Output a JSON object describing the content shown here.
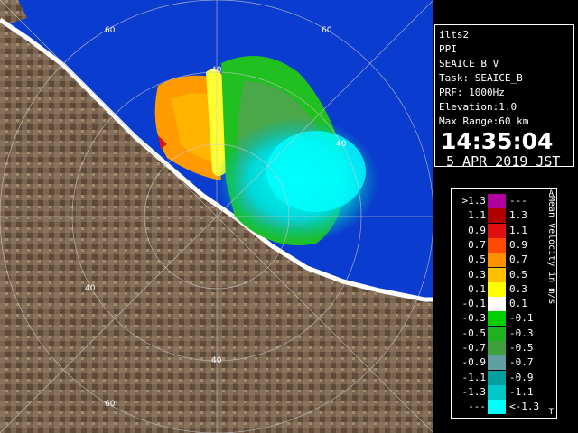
{
  "info": {
    "station": "ilts2",
    "mode": "PPI",
    "product": "SEAICE_B_V",
    "task": "Task: SEAICE_B",
    "prf": "PRF: 1000Hz",
    "elevation": "Elevation:1.0",
    "max_range": "Max Range:60 km",
    "time": "14:35:04",
    "date": "5 APR 2019 JST"
  },
  "legend": {
    "title": "Mean Velocity in m/s",
    "top_marker": "A",
    "bottom_marker": "T",
    "rows": [
      {
        "left": ">1.3",
        "right": "---",
        "color": "#b000a0"
      },
      {
        "left": "1.1",
        "right": "1.3",
        "color": "#b00000"
      },
      {
        "left": "0.9",
        "right": "1.1",
        "color": "#e01010"
      },
      {
        "left": "0.7",
        "right": "0.9",
        "color": "#ff4a00"
      },
      {
        "left": "0.5",
        "right": "0.7",
        "color": "#ff9000"
      },
      {
        "left": "0.3",
        "right": "0.5",
        "color": "#ffc000"
      },
      {
        "left": "0.1",
        "right": "0.3",
        "color": "#ffff00"
      },
      {
        "left": "-0.1",
        "right": "0.1",
        "color": "#ffffff"
      },
      {
        "left": "-0.3",
        "right": "-0.1",
        "color": "#00d000"
      },
      {
        "left": "-0.5",
        "right": "-0.3",
        "color": "#20b020"
      },
      {
        "left": "-0.7",
        "right": "-0.5",
        "color": "#40a040"
      },
      {
        "left": "-0.9",
        "right": "-0.7",
        "color": "#60a0a0"
      },
      {
        "left": "-1.1",
        "right": "-0.9",
        "color": "#00a0a0"
      },
      {
        "left": "-1.3",
        "right": "-1.1",
        "color": "#00c8c8"
      },
      {
        "left": "---",
        "right": "<-1.3",
        "color": "#00ffff"
      }
    ]
  },
  "map": {
    "range_labels": [
      "60",
      "60",
      "40",
      "40",
      "40",
      "40",
      "60"
    ],
    "colors": {
      "sea": "#0a3cd0",
      "land": "#7a6450",
      "coast": "#ffffff"
    }
  }
}
